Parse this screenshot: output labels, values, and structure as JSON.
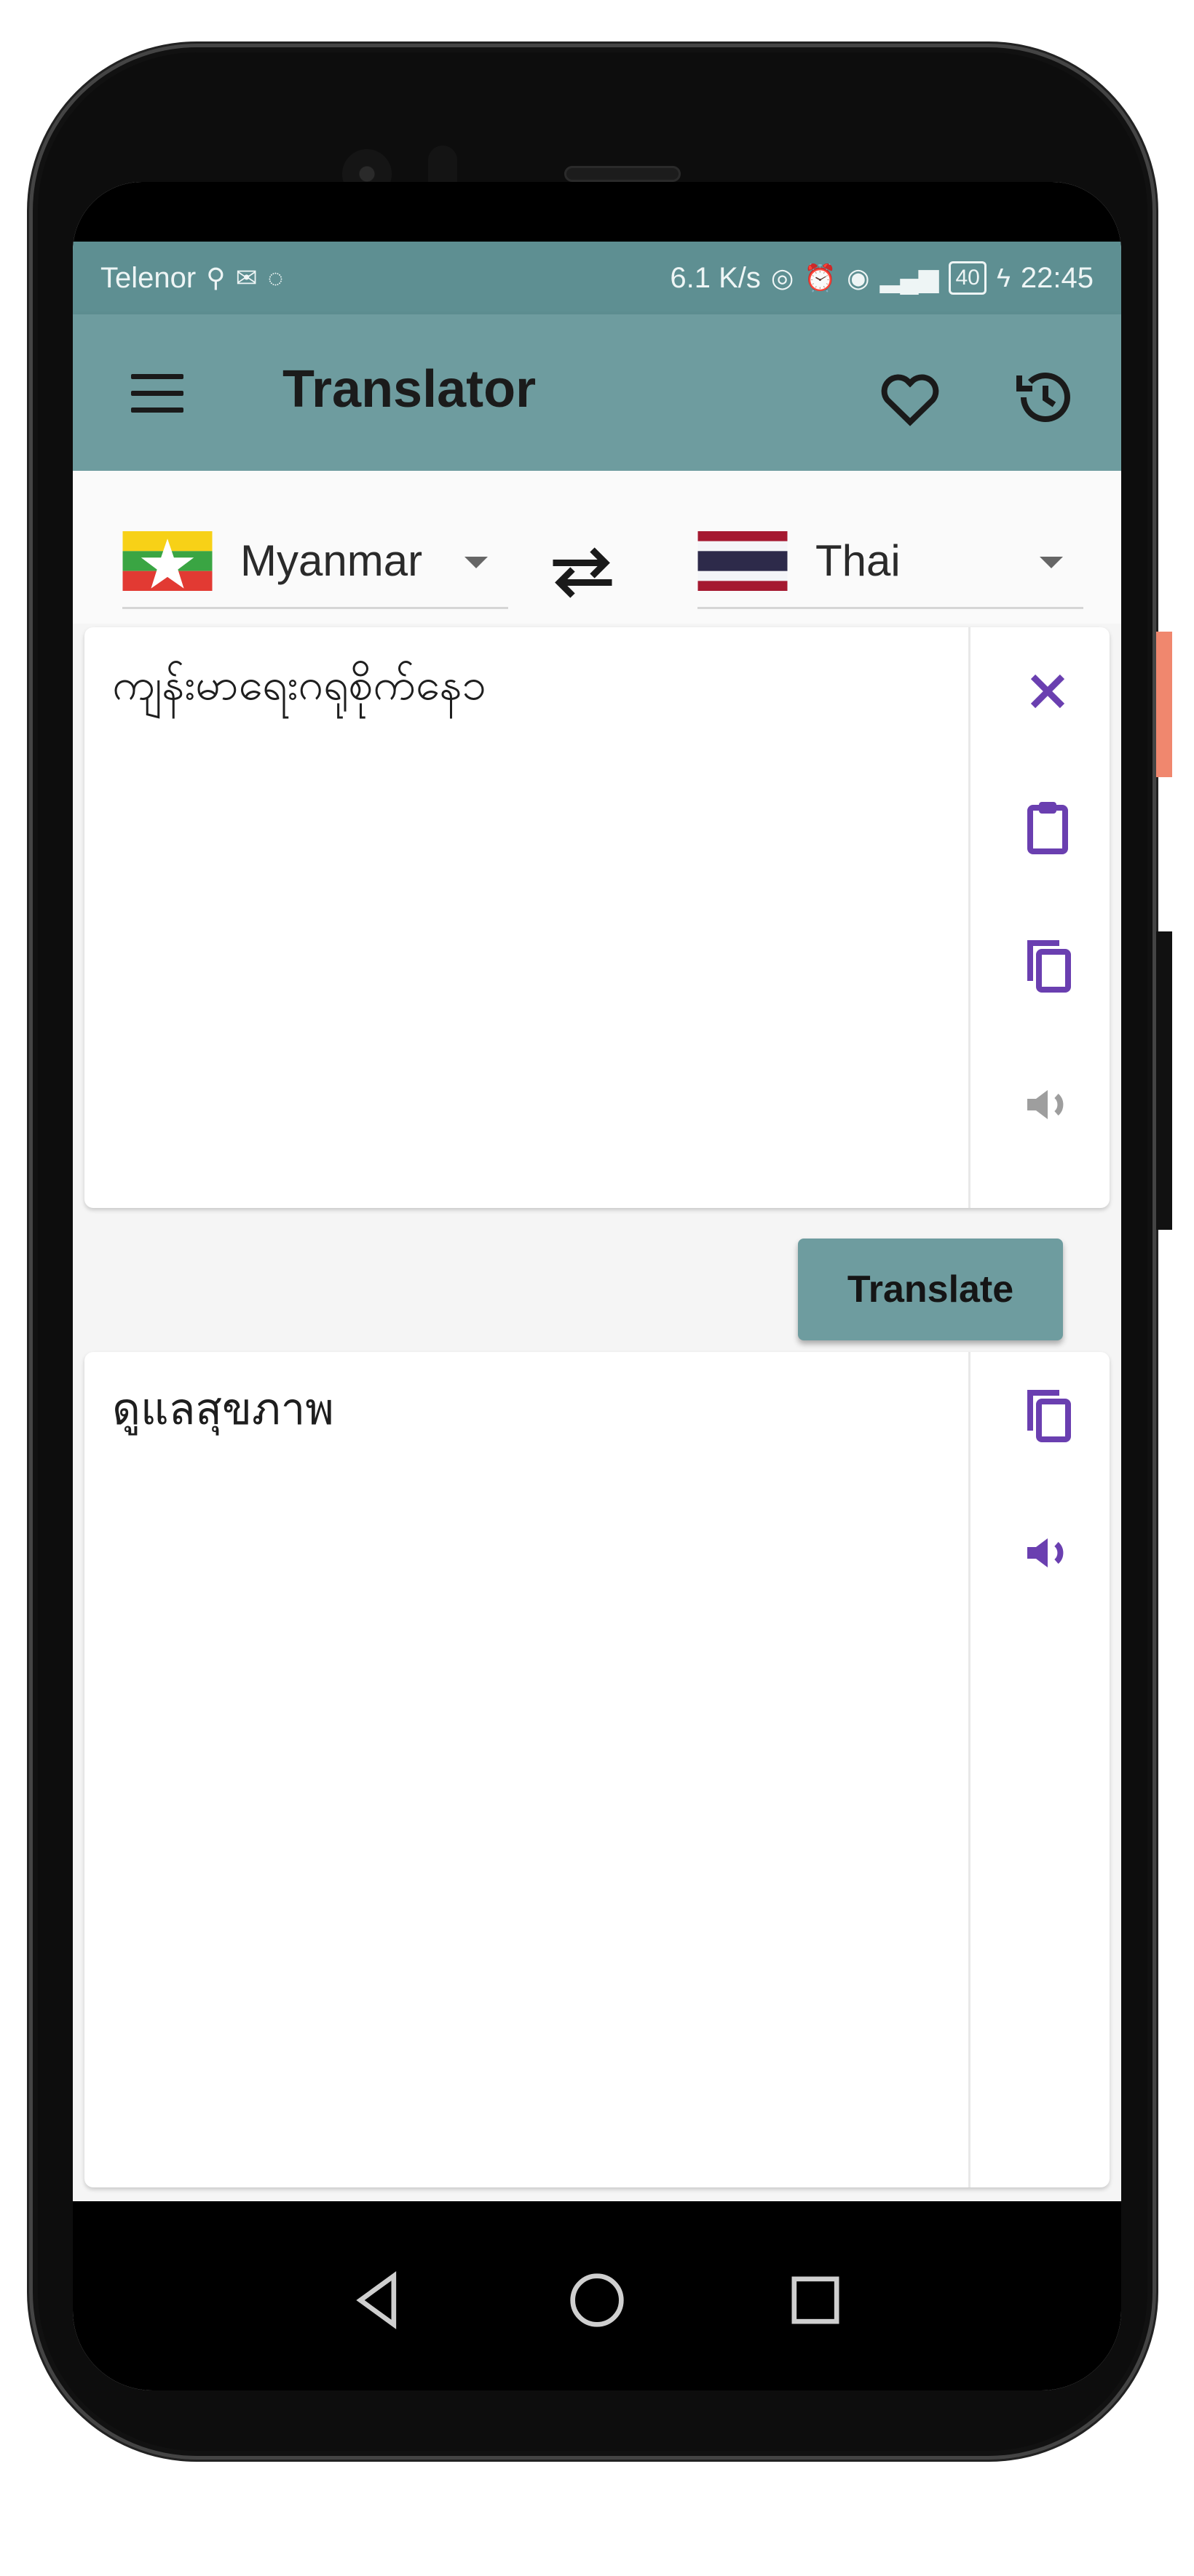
{
  "status_bar": {
    "carrier": "Telenor",
    "left_icons": [
      "usb-icon",
      "mail-icon",
      "messenger-icon"
    ],
    "net_speed": "6.1 K/s",
    "right_icons": [
      "hotspot-icon",
      "alarm-icon",
      "eye-comfort-icon",
      "signal-icon"
    ],
    "battery": "40",
    "time": "22:45"
  },
  "app_bar": {
    "title": "Translator",
    "icons": [
      "menu-icon",
      "heart-icon",
      "history-icon"
    ]
  },
  "languages": {
    "source": "Myanmar",
    "target": "Thai",
    "swap_icon": "swap-icon"
  },
  "input": {
    "text": "ကျန်းမာရေးဂရုစိုက်နေ၁",
    "actions": [
      "close-icon",
      "clipboard-icon",
      "copy-icon",
      "speaker-icon"
    ]
  },
  "translate_button": {
    "label": "Translate"
  },
  "output": {
    "text": "ดูแลสุขภาพ",
    "actions": [
      "copy-icon",
      "speaker-icon"
    ]
  },
  "colors": {
    "primary": "#6e9c9f",
    "status": "#5e8f92",
    "accent": "#6a3fb0"
  },
  "nav": [
    "back-icon",
    "home-icon",
    "recents-icon"
  ]
}
